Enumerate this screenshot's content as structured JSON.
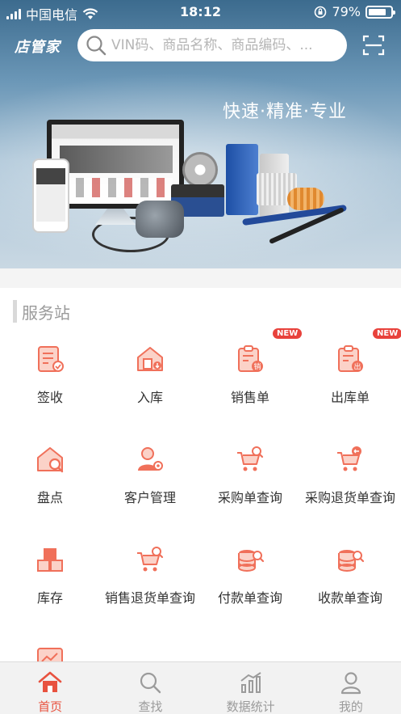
{
  "status_bar": {
    "carrier": "中国电信",
    "time": "18:12",
    "battery": "79%",
    "battery_level": 0.79
  },
  "header": {
    "logo_text": "店管家",
    "search_placeholder": "VIN码、商品名称、商品编码、..."
  },
  "banner": {
    "slogan": "快速·精准·专业"
  },
  "service_section": {
    "title": "服务站",
    "items": [
      {
        "label": "签收",
        "icon": "sign-receipt-icon",
        "new_badge": ""
      },
      {
        "label": "入库",
        "icon": "warehouse-in-icon",
        "new_badge": ""
      },
      {
        "label": "销售单",
        "icon": "sales-order-icon",
        "new_badge": "NEW"
      },
      {
        "label": "出库单",
        "icon": "outbound-order-icon",
        "new_badge": "NEW"
      },
      {
        "label": "盘点",
        "icon": "stocktake-icon",
        "new_badge": ""
      },
      {
        "label": "客户管理",
        "icon": "customer-management-icon",
        "new_badge": ""
      },
      {
        "label": "采购单查询",
        "icon": "purchase-query-icon",
        "new_badge": ""
      },
      {
        "label": "采购退货单查询",
        "icon": "purchase-return-query-icon",
        "new_badge": ""
      },
      {
        "label": "库存",
        "icon": "inventory-icon",
        "new_badge": ""
      },
      {
        "label": "销售退货单查询",
        "icon": "sales-return-query-icon",
        "new_badge": ""
      },
      {
        "label": "付款单查询",
        "icon": "payment-query-icon",
        "new_badge": ""
      },
      {
        "label": "收款单查询",
        "icon": "receipt-query-icon",
        "new_badge": ""
      },
      {
        "label": "",
        "icon": "report-icon",
        "new_badge": ""
      }
    ]
  },
  "tabbar": {
    "tabs": [
      {
        "label": "首页",
        "icon": "home-icon",
        "active": true
      },
      {
        "label": "查找",
        "icon": "search-icon",
        "active": false
      },
      {
        "label": "数据统计",
        "icon": "statistics-icon",
        "active": false
      },
      {
        "label": "我的",
        "icon": "profile-icon",
        "active": false
      }
    ]
  },
  "colors": {
    "accent": "#e8523f",
    "icon_orange": "#f0705a",
    "badge_red": "#e8423c",
    "tab_inactive": "#9b9b9b"
  }
}
